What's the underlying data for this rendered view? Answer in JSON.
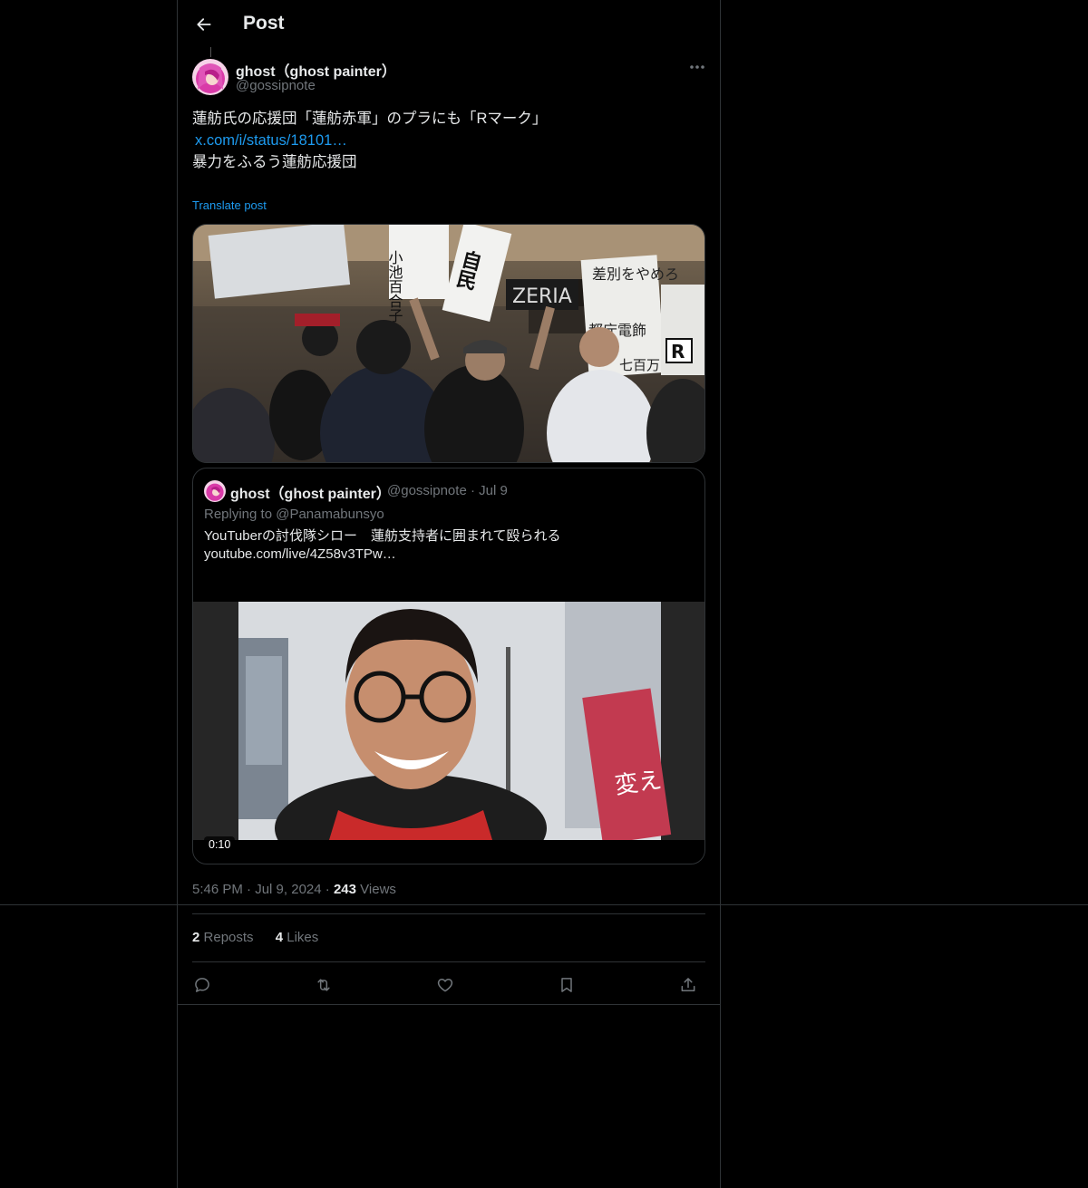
{
  "header": {
    "title": "Post"
  },
  "post": {
    "author_name": "ghost（ghost painter）",
    "author_handle": "@gossipnote",
    "text_line1": "蓮舫氏の応援団「蓮舫赤軍」のプラにも「Rマーク」",
    "link": "x.com/i/status/18101…",
    "text_line2": "暴力をふるう蓮舫応援団",
    "translate_label": "Translate post",
    "photo_signs": {
      "sign1": "小池百合子さよなら",
      "sign2": "自民",
      "sign3": "ZERIA",
      "sign4": "差別をやめろ",
      "sign5": "都庁電飾",
      "sign6": "R",
      "sign7": "七百万"
    },
    "time": "5:46 PM",
    "date": "Jul 9, 2024",
    "views_count": "243",
    "views_label": "Views",
    "reposts_count": "2",
    "reposts_label": "Reposts",
    "likes_count": "4",
    "likes_label": "Likes"
  },
  "quote": {
    "author_name": "ghost（ghost painter）",
    "author_handle": "@gossipnote",
    "date": "Jul 9",
    "replying_to": "Replying to @Panamabunsyo",
    "text_line1": "YouTuberの討伐隊シロー　蓮舫支持者に囲まれて殴られる",
    "text_line2": "youtube.com/live/4Z58v3TPw…",
    "video_duration": "0:10",
    "video_sign": "変え"
  },
  "icons": {
    "back": "arrow-left-icon",
    "more": "more-horizontal-icon",
    "reply": "reply-icon",
    "repost": "repost-icon",
    "like": "heart-icon",
    "bookmark": "bookmark-icon",
    "share": "share-icon"
  },
  "colors": {
    "background": "#000000",
    "text": "#e7e9ea",
    "muted": "#71767b",
    "accent": "#1d9bf0",
    "border": "#2f3336"
  }
}
